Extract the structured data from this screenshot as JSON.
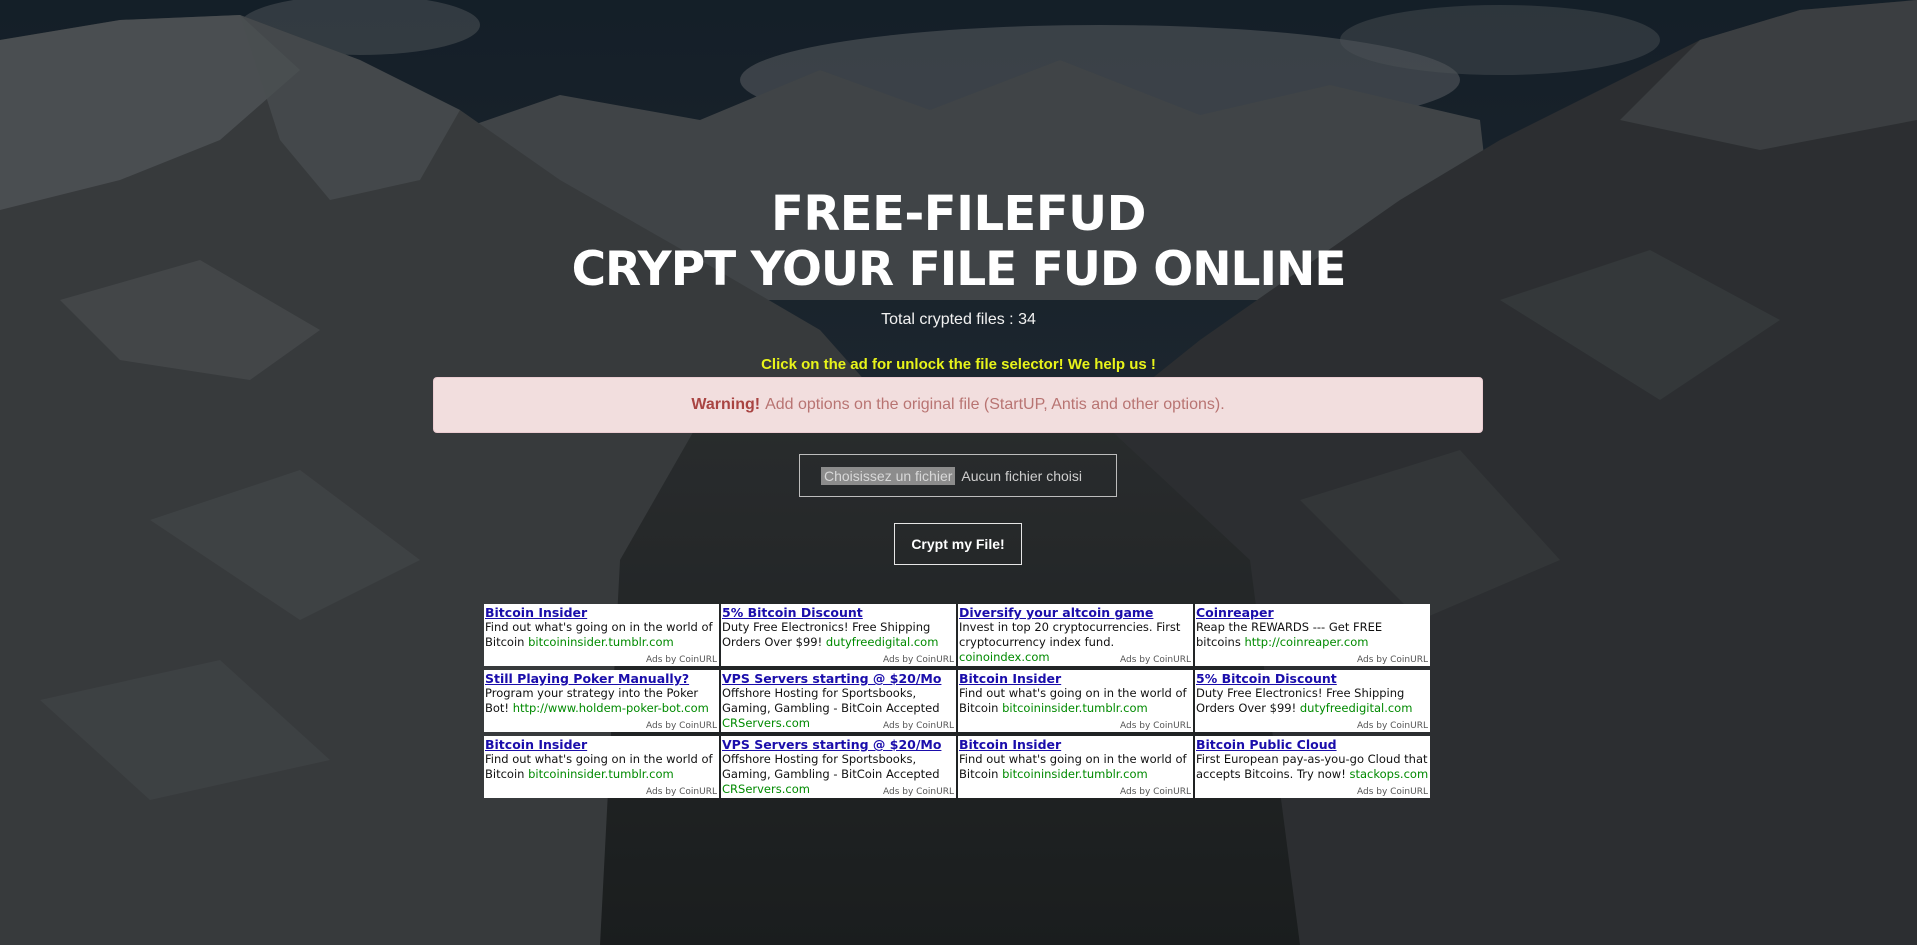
{
  "header": {
    "title_line1": "FREE-FILEFUD",
    "title_line2": "CRYPT YOUR FILE FUD ONLINE",
    "counter": "Total crypted files : 34"
  },
  "notice": "Click on the ad for unlock the file selector! We help us !",
  "alert": {
    "label": "Warning!",
    "message": "Add options on the original file (StartUP, Antis and other options)."
  },
  "file_input": {
    "button_label": "Choisissez un fichier",
    "status": "Aucun fichier choisi"
  },
  "submit": {
    "label": "Crypt my File!"
  },
  "colors": {
    "notice": "#e8f41a",
    "alert_bg": "#f2dede",
    "alert_text": "#a94442",
    "ad_title": "#1a0dab",
    "ad_url": "#008a00"
  },
  "ads": [
    {
      "title": "Bitcoin Insider",
      "desc": "Find out what's going on in the world of Bitcoin",
      "url": "bitcoininsider.tumblr.com",
      "credit": "Ads by CoinURL"
    },
    {
      "title": "5% Bitcoin Discount",
      "desc": "Duty Free Electronics! Free Shipping Orders Over $99!",
      "url": "dutyfreedigital.com",
      "credit": "Ads by CoinURL"
    },
    {
      "title": "Diversify your altcoin game",
      "desc": "Invest in top 20 cryptocurrencies. First cryptocurrency index fund.",
      "url": "coinoindex.com",
      "credit": "Ads by CoinURL"
    },
    {
      "title": "Coinreaper",
      "desc": "Reap the REWARDS --- Get FREE bitcoins",
      "url": "http://coinreaper.com",
      "credit": "Ads by CoinURL"
    },
    {
      "title": "Still Playing Poker Manually?",
      "desc": "Program your strategy into the Poker Bot!",
      "url": "http://www.holdem-poker-bot.com",
      "credit": "Ads by CoinURL"
    },
    {
      "title": "VPS Servers starting @ $20/Mo",
      "desc": "Offshore Hosting for Sportsbooks, Gaming, Gambling - BitCoin Accepted",
      "url": "CRServers.com",
      "credit": "Ads by CoinURL"
    },
    {
      "title": "Bitcoin Insider",
      "desc": "Find out what's going on in the world of Bitcoin",
      "url": "bitcoininsider.tumblr.com",
      "credit": "Ads by CoinURL"
    },
    {
      "title": "5% Bitcoin Discount",
      "desc": "Duty Free Electronics! Free Shipping Orders Over $99!",
      "url": "dutyfreedigital.com",
      "credit": "Ads by CoinURL"
    },
    {
      "title": "Bitcoin Insider",
      "desc": "Find out what's going on in the world of Bitcoin",
      "url": "bitcoininsider.tumblr.com",
      "credit": "Ads by CoinURL"
    },
    {
      "title": "VPS Servers starting @ $20/Mo",
      "desc": "Offshore Hosting for Sportsbooks, Gaming, Gambling - BitCoin Accepted",
      "url": "CRServers.com",
      "credit": "Ads by CoinURL"
    },
    {
      "title": "Bitcoin Insider",
      "desc": "Find out what's going on in the world of Bitcoin",
      "url": "bitcoininsider.tumblr.com",
      "credit": "Ads by CoinURL"
    },
    {
      "title": "Bitcoin Public Cloud",
      "desc": "First European pay-as-you-go Cloud that accepts Bitcoins. Try now!",
      "url": "stackops.com",
      "credit": "Ads by CoinURL"
    }
  ]
}
